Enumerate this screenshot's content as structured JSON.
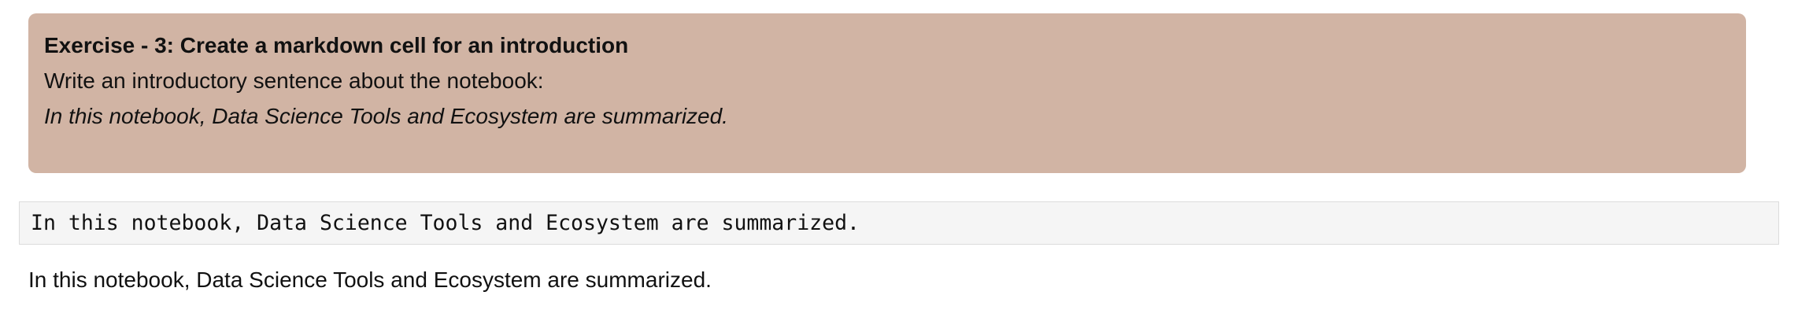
{
  "exercise_cell": {
    "title": "Exercise - 3: Create a markdown cell for an introduction",
    "instruction": "Write an introductory sentence about the notebook:",
    "answer": "In this notebook, Data Science Tools and Ecosystem are summarized.",
    "background_color": "#d1b4a4"
  },
  "raw_cell": {
    "code": "In this notebook, Data Science Tools and Ecosystem are summarized."
  },
  "rendered_markdown": {
    "text": "In this notebook, Data Science Tools and Ecosystem are summarized."
  }
}
